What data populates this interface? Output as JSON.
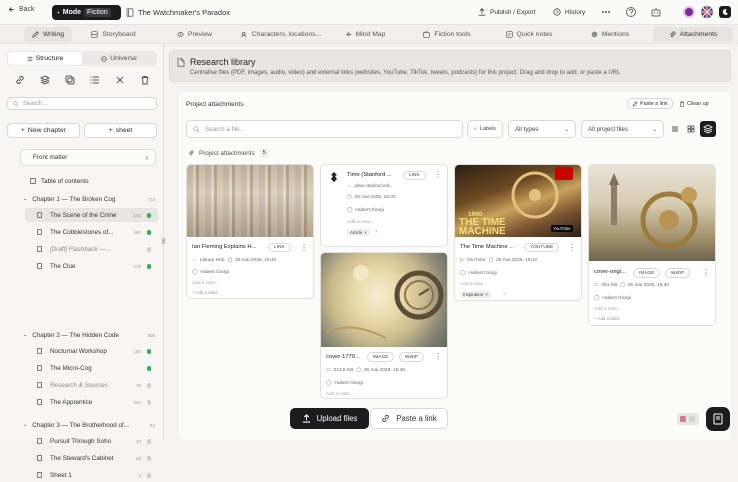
{
  "topbar": {
    "back": "Back",
    "mode_label": "Mode",
    "mode_value": "Fiction",
    "project_title": "The Watchmaker's Paradox",
    "publish": "Publish / Export",
    "history": "History"
  },
  "tabs": [
    "Writing",
    "Storyboard",
    "Preview",
    "Characters, locations...",
    "Mind Map",
    "Fiction tools",
    "Quick notes",
    "Mentions",
    "Attachments"
  ],
  "sidebar": {
    "seg": [
      "Structure",
      "Universe"
    ],
    "search_placeholder": "Search...",
    "new_chapter": "New chapter",
    "sheet": "sheet",
    "front_matter": "Front matter",
    "toc": "Table of contents",
    "ch1": {
      "title": "Chapter 1 — The Broken Cog",
      "count": "713"
    },
    "ch1_items": [
      {
        "label": "The Scene of the Crime",
        "count": "145",
        "color": "#2fb15a"
      },
      {
        "label": "The Cobblestones of...",
        "count": "260",
        "color": "#2fb15a"
      },
      {
        "label": "[Draft] Flashback —...",
        "count": "",
        "color": "#cfcfcf"
      },
      {
        "label": "The Clue",
        "count": "178",
        "color": "#2fb15a"
      }
    ],
    "ch2": {
      "title": "Chapter 2 — The Hidden Code",
      "count": "506"
    },
    "ch2_items": [
      {
        "label": "Nocturnal Workshop",
        "count": "182",
        "color": "#2fb15a"
      },
      {
        "label": "The Micro-Cog",
        "count": "",
        "color": "#2fb15a"
      },
      {
        "label": "Research & Sources",
        "count": "70",
        "color": "#cfcfcf"
      },
      {
        "label": "The Apprentice",
        "count": "234",
        "color": "#cfcfcf"
      }
    ],
    "ch3": {
      "title": "Chapter 3 — The Brotherhood of...",
      "count": "64"
    },
    "ch3_items": [
      {
        "label": "Pursuit Through Soho",
        "count": "24",
        "color": "#cfcfcf"
      },
      {
        "label": "The Steward's Cabinet",
        "count": "38",
        "color": "#cfcfcf"
      },
      {
        "label": "Sheet 1",
        "count": "2",
        "color": "#cfcfcf"
      }
    ]
  },
  "library": {
    "title": "Research library",
    "desc": "Centralise files (PDF, images, audio, video) and external links (websites, YouTube, TikTok, tweets, podcasts) for this project. Drag and drop to add, or paste a URL"
  },
  "panel": {
    "title": "Project attachments",
    "paste_link": "Paste a link",
    "clean_up": "Clean up",
    "search_placeholder": "Search a file...",
    "labels": "Labels",
    "all_types": "All types",
    "all_project_files": "All project files",
    "section": "Project attachments",
    "section_count": "5"
  },
  "cards": [
    {
      "name": "Ian Fleming Explains H...",
      "type": "LINK",
      "meta1": "Library Hub",
      "date": "20 mai 2026, 19:40",
      "author": "Hubert Giorgi",
      "note": "Add a note...",
      "label": "+ Add a label"
    },
    {
      "name": "Time (Stanford ...",
      "type": "LINK",
      "source": "plato.stanford.edu",
      "date": "26 mai 2026, 15:40",
      "author": "Hubert Giorgi",
      "note": "Add a note...",
      "tag": "Article"
    },
    {
      "name": "cover-1779...",
      "type": "IMAGE",
      "fmt": "WebP",
      "size": "213.5 KB",
      "date": "26 mai 2026, 15:40",
      "author": "Hubert Giorgi",
      "note": "Add a note...",
      "label": "+ Add a label"
    },
    {
      "name": "The Time Machine ...",
      "type": "YOUTUBE",
      "meta1": "YouTube",
      "date": "20 mai 2026, 19:42",
      "author": "Hubert Giorgi",
      "note": "Add a note...",
      "tag": "Inspiration",
      "thumb_text": "THE TIME MACHINE",
      "thumb_year": "1960",
      "yt": "YouTube"
    },
    {
      "name": "cover-origi...",
      "type": "IMAGE",
      "fmt": "WebP",
      "size": "251 KB",
      "date": "26 mai 2026, 15:40",
      "author": "Hubert Giorgi",
      "note": "Add a note...",
      "label": "+ Add a label"
    }
  ],
  "bottom": {
    "upload": "Upload files",
    "paste": "Paste a link"
  }
}
